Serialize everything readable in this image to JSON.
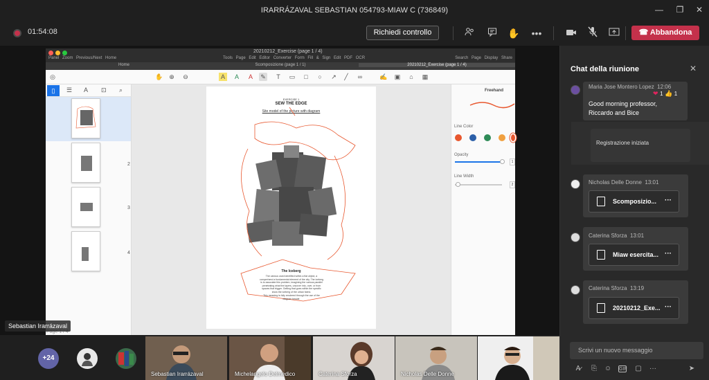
{
  "window": {
    "title": "IRARRÁZAVAL SEBASTIAN 054793-MIAW C (736849)"
  },
  "toolbar": {
    "timer": "01:54:08",
    "control_label": "Richiedi controllo",
    "leave_label": "Abbandona"
  },
  "shared": {
    "doc_title": "20210212_Exercise (page 1 / 4)",
    "menu_left": "Panel Zoom Previous/Next Home",
    "menu_mid": "Tools Page Edit Editor Converter Form Fill & Sign Edit PDF OCR",
    "menu_right": "Search Page Display Share",
    "tabs": [
      "Home",
      "Scomposizione (page 1 / 1)",
      "20210212_Exercise (page 1 / 4)"
    ],
    "page_numbers": [
      "2",
      "3",
      "4"
    ],
    "footer_page": "Page 1 / 4",
    "doc_heading_small": "EXERCISE 1",
    "doc_heading": "SEW THE EDGE",
    "doc_subheading": "Site model of the picture with diagram",
    "doc_section": "The Iceberg",
    "doc_body": "The various used identified within a flat object, a comprehend a fundamental element of the city. The iceberg is to associate this problem, imagining the various parallel penetrating what the layers, uncover into, over, or from spaces that trigger. Getting that goes within the specific show the iceberg of the urban fabric.",
    "doc_body2": "This meaning is fully rendered through the use of the diagram beside.",
    "right_panel": {
      "tool": "Freehand",
      "line_color_label": "Line Color",
      "opacity_label": "Opacity",
      "line_width_label": "Line Width",
      "opacity_value": "1",
      "width_value": "2",
      "colors": [
        "#e8572e",
        "#2b5fa8",
        "#2e8b57",
        "#f0a040",
        "#e8572e"
      ]
    },
    "presenter_label": "Sebastian Irarrázaval"
  },
  "chat": {
    "title": "Chat della riunione",
    "messages": [
      {
        "author": "Maria Jose Montero Lopez",
        "time": "12:06",
        "text_lines": [
          "Good morning professor,",
          "Riccardo and Bice"
        ],
        "reactions": [
          {
            "icon": "heart-icon",
            "count": "1"
          },
          {
            "icon": "thumbs-up-icon",
            "count": "1"
          }
        ]
      },
      {
        "system": "Registrazione iniziata"
      },
      {
        "author": "Nicholas Delle Donne",
        "time": "13:01",
        "file": "Scomposizio..."
      },
      {
        "author": "Caterina Sforza",
        "time": "13:01",
        "file": "Miaw esercita..."
      },
      {
        "author": "Caterina Sforza",
        "time": "13:19",
        "file": "20210212_Exe..."
      }
    ],
    "input_placeholder": "Scrivi un nuovo messaggio"
  },
  "gallery": {
    "overflow_count": "+24",
    "participants": [
      "Sebastian Irarrázaval",
      "Michelangelo Delmedico",
      "Caterina Sforza",
      "Nicholas Delle Donne",
      ""
    ]
  }
}
